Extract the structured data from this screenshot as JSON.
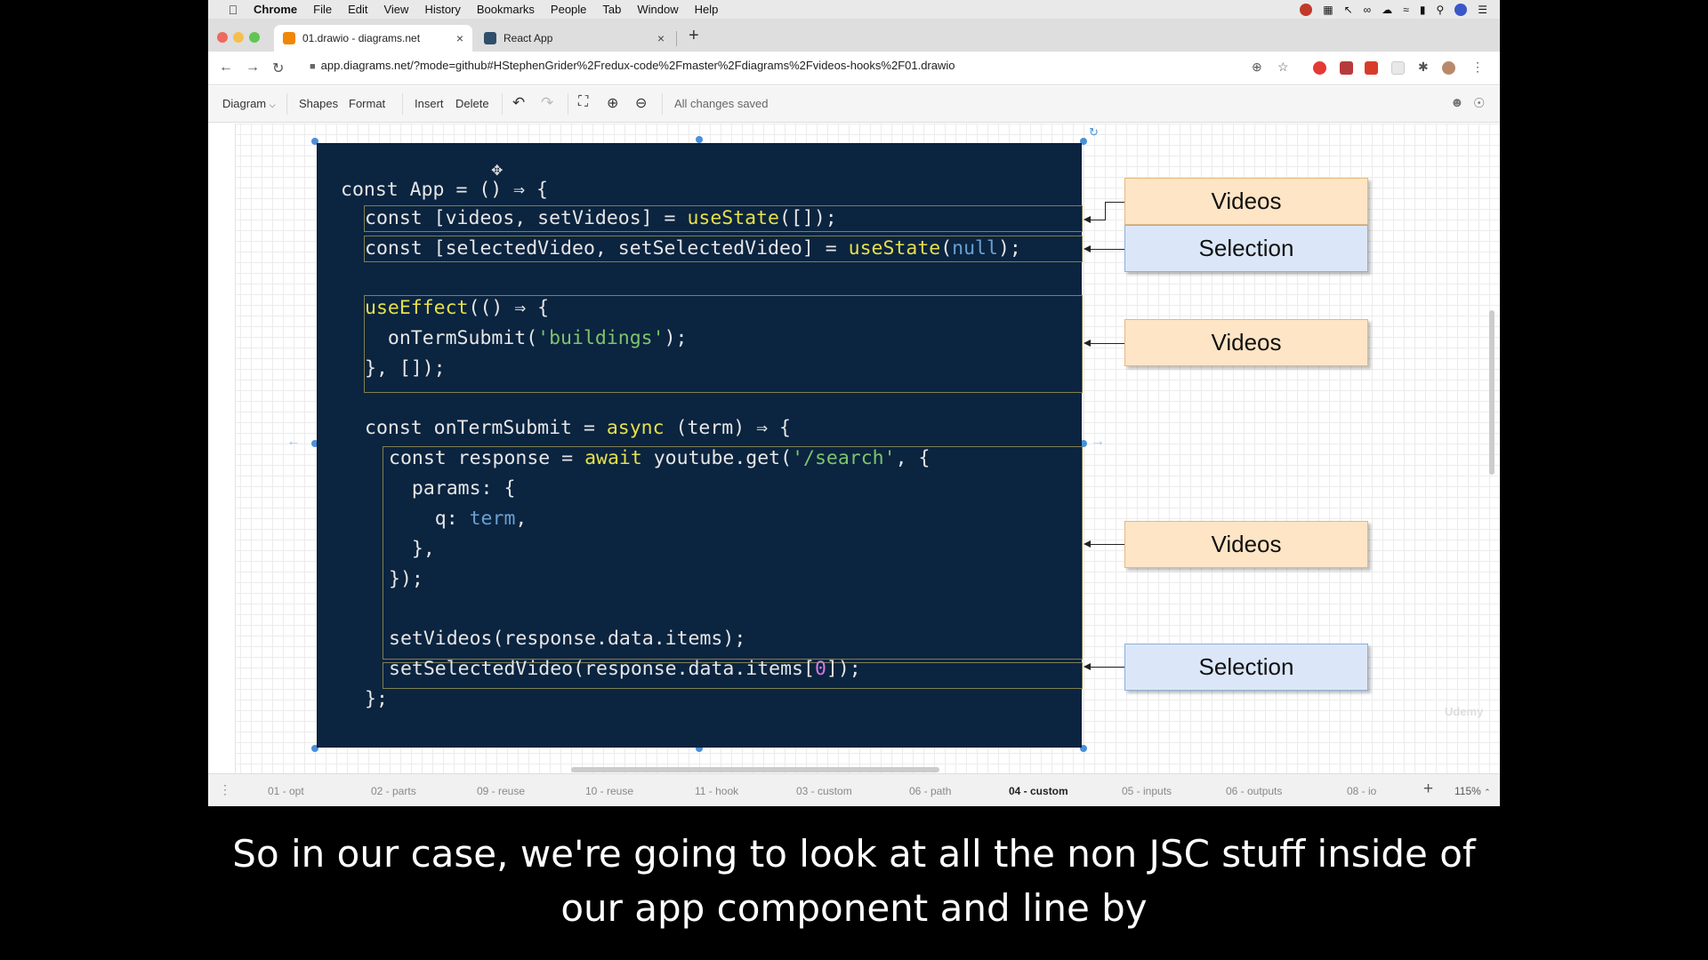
{
  "menubar": {
    "app": "Chrome",
    "items": [
      "File",
      "Edit",
      "View",
      "History",
      "Bookmarks",
      "People",
      "Tab",
      "Window",
      "Help"
    ]
  },
  "tabs": [
    {
      "title": "01.drawio - diagrams.net",
      "favicon_color": "#f08705",
      "active": true
    },
    {
      "title": "React App",
      "favicon_color": "#2f4e6c",
      "active": false
    }
  ],
  "address": {
    "url": "app.diagrams.net/?mode=github#HStephenGrider%2Fredux-code%2Fmaster%2Fdiagrams%2Fvideos-hooks%2F01.drawio"
  },
  "toolbar": {
    "diagram": "Diagram",
    "shapes": "Shapes",
    "format": "Format",
    "insert": "Insert",
    "delete": "Delete",
    "status": "All changes saved"
  },
  "code": {
    "l1": "const App = () ⇒ {",
    "l2a": "const [videos, setVideos] = ",
    "l2b": "useState",
    "l2c": "([]);",
    "l3a": "const [selectedVideo, setSelectedVideo] = ",
    "l3b": "useState",
    "l3c": "(",
    "l3d": "null",
    "l3e": ");",
    "l4a": "useEffect",
    "l4b": "(() ⇒ {",
    "l5a": "  onTermSubmit(",
    "l5b": "'buildings'",
    "l5c": ");",
    "l6": "}, []);",
    "l7a": "const onTermSubmit = ",
    "l7b": "async",
    "l7c": " (term) ⇒ {",
    "l8a": "const response = ",
    "l8b": "await",
    "l8c": " youtube.get(",
    "l8d": "'/search'",
    "l8e": ", {",
    "l9": "  params: {",
    "l10a": "    q: ",
    "l10b": "term",
    "l10c": ",",
    "l11": "  },",
    "l12": "});",
    "l13": "setVideos(response.data.items);",
    "l14a": "setSelectedVideo(response.data.items[",
    "l14b": "0",
    "l14c": "]);",
    "l15": "};"
  },
  "labels": [
    "Videos",
    "Selection",
    "Videos",
    "Videos",
    "Selection"
  ],
  "pages": [
    "01 - opt",
    "02 - parts",
    "09 - reuse",
    "10 - reuse",
    "11 - hook",
    "03 - custom",
    "06 - path",
    "04 - custom",
    "05 - inputs",
    "06 - outputs",
    "08 - io"
  ],
  "active_page": "04 - custom",
  "zoom": "115%",
  "caption": {
    "line1": "So in our case, we're going to look at all the non JSC stuff inside of",
    "line2": "our app component and line by"
  },
  "colors": {
    "code_bg": "#0b2440",
    "videos_fill": "#fde5c5",
    "selection_fill": "#dbe7f8"
  }
}
